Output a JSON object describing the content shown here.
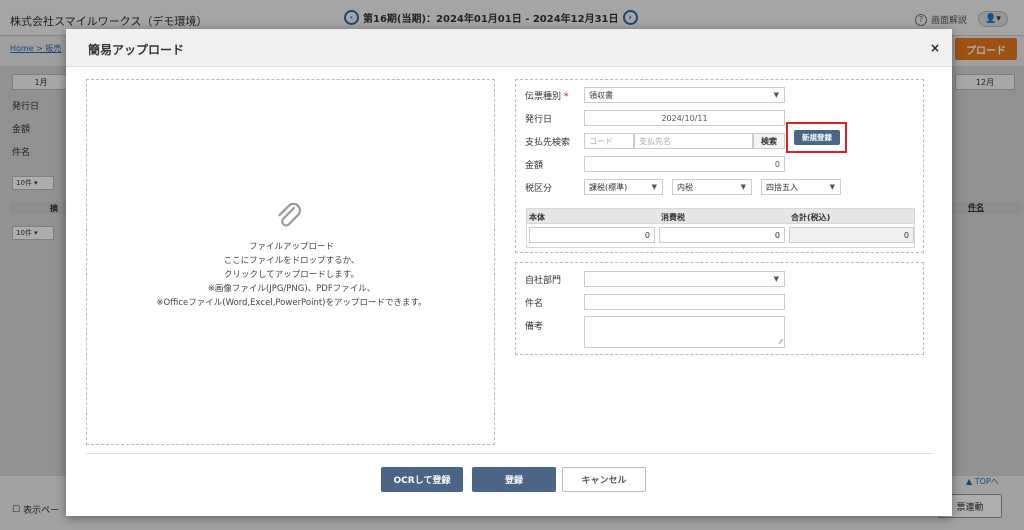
{
  "background": {
    "company": "株式会社スマイルワークス（デモ環境）",
    "period": "第16期(当期)：2024年01月01日 - 2024年12月31日",
    "help": "画面解説",
    "breadcrumb": "Home > 販売",
    "upload_btn": "プロード",
    "months": {
      "first": "1月",
      "last": "12月"
    },
    "side_labels": [
      "発行日",
      "金額",
      "件名"
    ],
    "per_page": "10件",
    "col_right": "件名",
    "col_left": "摘",
    "top_link": "▲ TOPへ",
    "display_checkbox": "表示ペー",
    "link_btn": "票連動"
  },
  "modal": {
    "title": "簡易アップロード",
    "close": "×",
    "dropzone": {
      "icon": "paperclip-icon",
      "lines": [
        "ファイルアップロード",
        "ここにファイルをドロップするか、",
        "クリックしてアップロードします。",
        "※画像ファイル(JPG/PNG)、PDFファイル、",
        "※Officeファイル(Word,Excel,PowerPoint)をアップロードできます。"
      ]
    },
    "form": {
      "slip_type_label": "伝票種別",
      "required_mark": "*",
      "slip_type_value": "領収書",
      "issue_date_label": "発行日",
      "issue_date_value": "2024/10/11",
      "payee_label": "支払先検索",
      "payee_code_placeholder": "コード",
      "payee_name_placeholder": "支払先名",
      "search_btn": "検索",
      "new_register_btn": "新規登録",
      "amount_label": "金額",
      "amount_value": "0",
      "tax_label": "税区分",
      "tax_type": "課税(標準)",
      "tax_inclusion": "内税",
      "rounding": "四捨五入",
      "amount_table": {
        "headers": [
          "本体",
          "消費税",
          "合計(税込)"
        ],
        "values": [
          "0",
          "0",
          "0"
        ]
      },
      "department_label": "自社部門",
      "department_value": "",
      "subject_label": "件名",
      "subject_value": "",
      "remarks_label": "備考",
      "remarks_value": ""
    },
    "buttons": {
      "ocr_register": "OCRして登録",
      "register": "登録",
      "cancel": "キャンセル"
    }
  }
}
